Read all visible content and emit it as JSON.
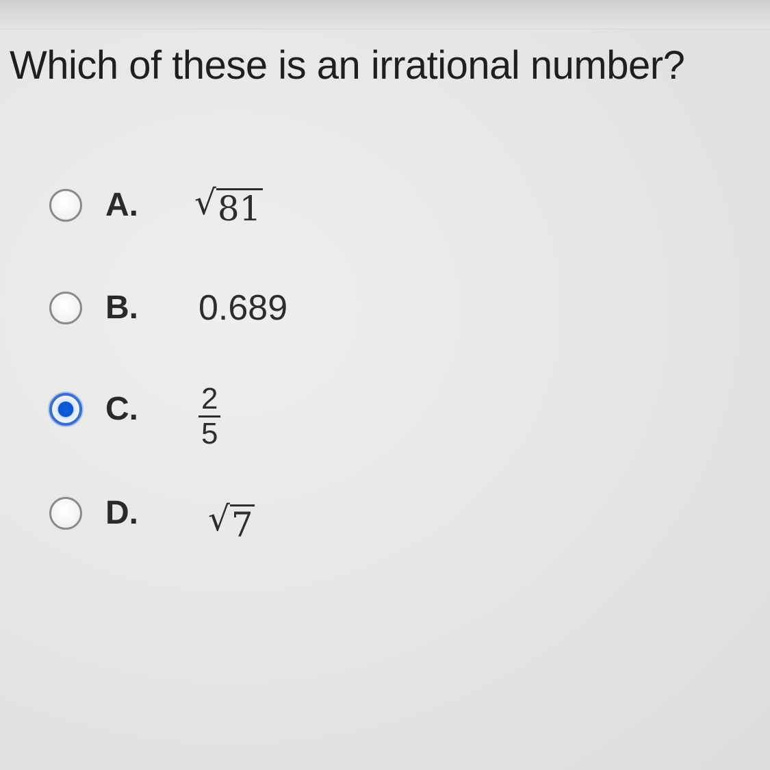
{
  "question": {
    "text": "Which of these is an irrational number?"
  },
  "choices": [
    {
      "letter": "A.",
      "type": "sqrt",
      "radical": "√",
      "radicand": "81",
      "selected": false
    },
    {
      "letter": "B.",
      "type": "text",
      "value": "0.689",
      "selected": false
    },
    {
      "letter": "C.",
      "type": "fraction",
      "numerator": "2",
      "denominator": "5",
      "selected": true
    },
    {
      "letter": "D.",
      "type": "sqrt",
      "radical": "√",
      "radicand": "7",
      "selected": false
    }
  ],
  "colors": {
    "selected_radio": "#0a55d0",
    "text": "#222222"
  },
  "icons": {
    "radio_unselected": "radio-unchecked-icon",
    "radio_selected": "radio-checked-icon"
  }
}
